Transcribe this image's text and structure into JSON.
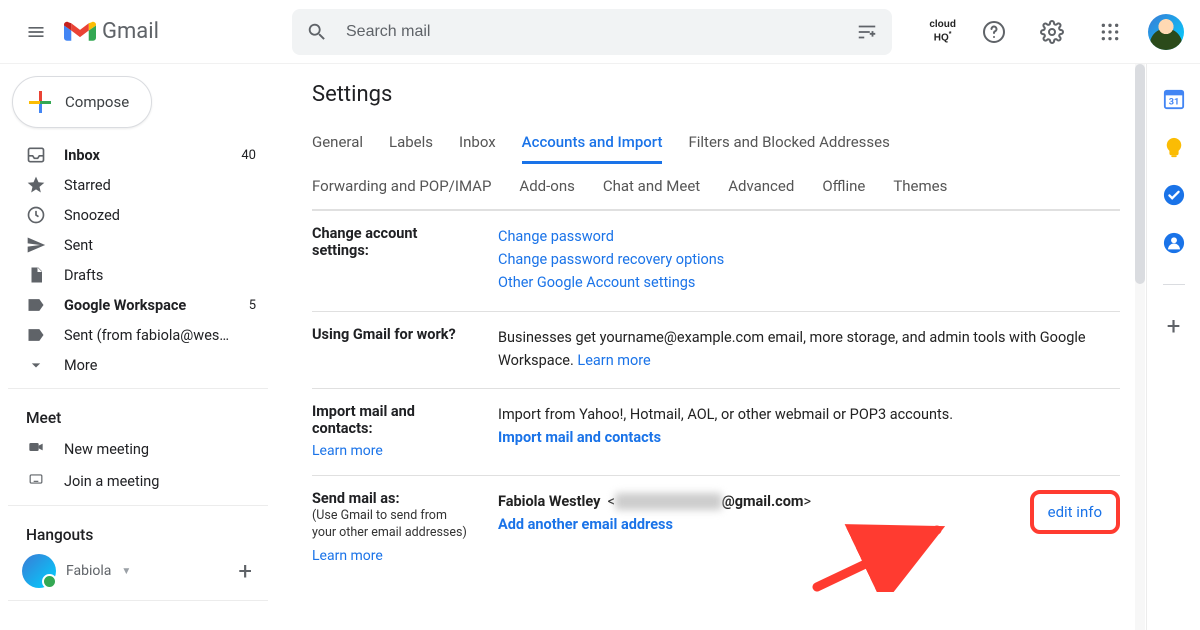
{
  "header": {
    "brand": "Gmail",
    "search_placeholder": "Search mail",
    "cloudhq": "cloud\nHQ"
  },
  "compose_label": "Compose",
  "sidebar": {
    "items": [
      {
        "icon": "inbox",
        "label": "Inbox",
        "count": "40",
        "bold": true
      },
      {
        "icon": "star",
        "label": "Starred"
      },
      {
        "icon": "clock",
        "label": "Snoozed"
      },
      {
        "icon": "send",
        "label": "Sent"
      },
      {
        "icon": "file",
        "label": "Drafts"
      },
      {
        "icon": "tag",
        "label": "Google Workspace",
        "count": "5",
        "bold": true
      },
      {
        "icon": "tag",
        "label": "Sent (from fabiola@wes…"
      },
      {
        "icon": "chevron",
        "label": "More"
      }
    ],
    "meet_label": "Meet",
    "meet_items": [
      {
        "icon": "camera",
        "label": "New meeting"
      },
      {
        "icon": "keyboard",
        "label": "Join a meeting"
      }
    ],
    "hangouts_label": "Hangouts",
    "hangouts_user": "Fabiola"
  },
  "page_title": "Settings",
  "tabs_row1": [
    "General",
    "Labels",
    "Inbox",
    "Accounts and Import",
    "Filters and Blocked Addresses"
  ],
  "tabs_row2": [
    "Forwarding and POP/IMAP",
    "Add-ons",
    "Chat and Meet",
    "Advanced",
    "Offline",
    "Themes"
  ],
  "active_tab": "Accounts and Import",
  "sections": {
    "change": {
      "label": "Change account settings:",
      "links": [
        "Change password",
        "Change password recovery options",
        "Other Google Account settings"
      ]
    },
    "work": {
      "label": "Using Gmail for work?",
      "text": "Businesses get yourname@example.com email, more storage, and admin tools with Google Workspace. ",
      "learn": "Learn more"
    },
    "import": {
      "label": "Import mail and contacts:",
      "text": "Import from Yahoo!, Hotmail, AOL, or other webmail or POP3 accounts.",
      "action": "Import mail and contacts",
      "learn": "Learn more"
    },
    "sendas": {
      "label": "Send mail as:",
      "sub": "(Use Gmail to send from your other email addresses)",
      "name": "Fabiola Westley",
      "email_hidden": "██████████",
      "email_suffix": "@gmail.com",
      "add": "Add another email address",
      "edit": "edit info",
      "learn": "Learn more"
    }
  },
  "sidepanel": {
    "calendar_day": "31"
  }
}
